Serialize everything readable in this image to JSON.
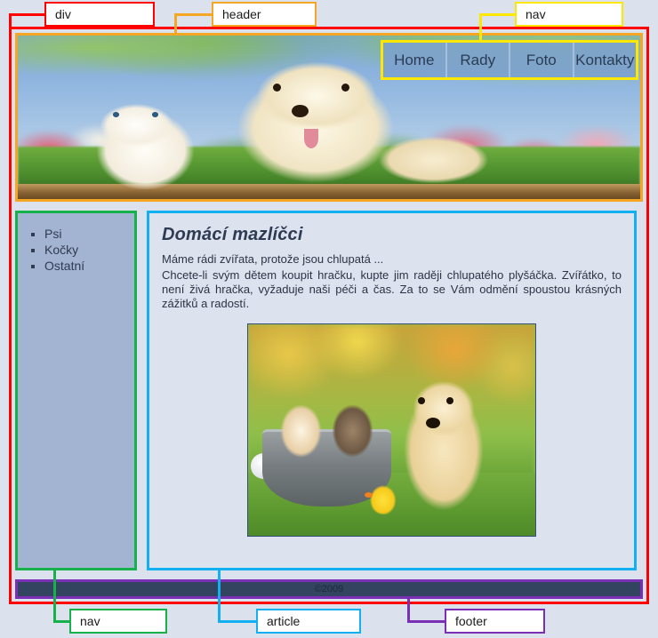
{
  "page": {
    "background_color": "#dbe2ee"
  },
  "annotations": [
    {
      "label": "div",
      "color": "#ff0000"
    },
    {
      "label": "header",
      "color": "#f5a623"
    },
    {
      "label": "nav",
      "color": "#ffe800"
    },
    {
      "label": "nav",
      "color": "#16b14b"
    },
    {
      "label": "article",
      "color": "#12b0f0"
    },
    {
      "label": "footer",
      "color": "#7b2fb5"
    }
  ],
  "header": {
    "banner_image_alt": "white kitten and cream puppy sitting on a wooden ledge with blue sky and flowers",
    "nav": {
      "items": [
        {
          "label": "Home"
        },
        {
          "label": "Rady"
        },
        {
          "label": "Foto"
        },
        {
          "label": "Kontakty"
        }
      ]
    }
  },
  "sidebar": {
    "items": [
      {
        "label": "Psi"
      },
      {
        "label": "Kočky"
      },
      {
        "label": "Ostatní"
      }
    ]
  },
  "article": {
    "title": "Domácí mazlíčci",
    "paragraphs": [
      "Máme rádi zvířata, protože jsou chlupatá ...",
      "Chcete-li svým  dětem koupit hračku, kupte  jim raději chlupatého plyšáčka. Zvířátko, to  není živá  hračka,  vyžaduje  naši  péči  a  čas.  Za  to  se  Vám  odmění  spoustou  krásných  zážitků a radostí."
    ],
    "photo_alt": "two kittens in a metal tub beside a golden retriever puppy and a rubber duck on grass"
  },
  "footer": {
    "copyright": "©2009"
  }
}
